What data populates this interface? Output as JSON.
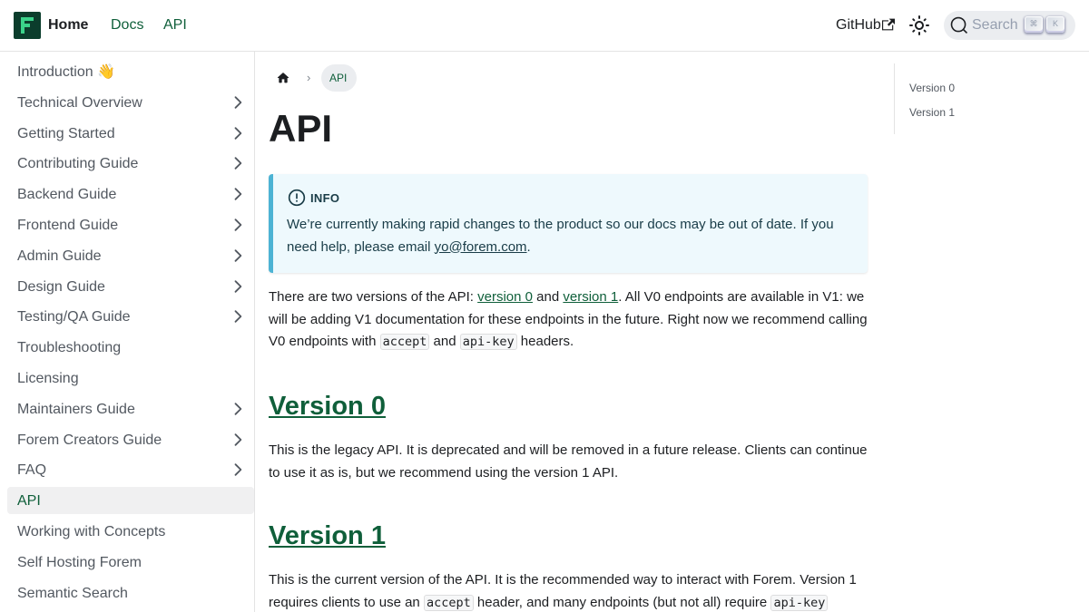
{
  "navbar": {
    "brand": "Home",
    "links": [
      "Docs",
      "API"
    ],
    "github": "GitHub",
    "search_placeholder": "Search",
    "kbd_keys": [
      "⌘",
      "K"
    ]
  },
  "sidebar": {
    "items": [
      {
        "label": "Introduction 👋",
        "has_children": false,
        "active": false
      },
      {
        "label": "Technical Overview",
        "has_children": true,
        "active": false
      },
      {
        "label": "Getting Started",
        "has_children": true,
        "active": false
      },
      {
        "label": "Contributing Guide",
        "has_children": true,
        "active": false
      },
      {
        "label": "Backend Guide",
        "has_children": true,
        "active": false
      },
      {
        "label": "Frontend Guide",
        "has_children": true,
        "active": false
      },
      {
        "label": "Admin Guide",
        "has_children": true,
        "active": false
      },
      {
        "label": "Design Guide",
        "has_children": true,
        "active": false
      },
      {
        "label": "Testing/QA Guide",
        "has_children": true,
        "active": false
      },
      {
        "label": "Troubleshooting",
        "has_children": false,
        "active": false
      },
      {
        "label": "Licensing",
        "has_children": false,
        "active": false
      },
      {
        "label": "Maintainers Guide",
        "has_children": true,
        "active": false
      },
      {
        "label": "Forem Creators Guide",
        "has_children": true,
        "active": false
      },
      {
        "label": "FAQ",
        "has_children": true,
        "active": false
      },
      {
        "label": "API",
        "has_children": false,
        "active": true
      },
      {
        "label": "Working with Concepts",
        "has_children": false,
        "active": false
      },
      {
        "label": "Self Hosting Forem",
        "has_children": false,
        "active": false
      },
      {
        "label": "Semantic Search",
        "has_children": false,
        "active": false
      }
    ]
  },
  "breadcrumb": {
    "current": "API"
  },
  "page": {
    "title": "API",
    "info": {
      "title": "INFO",
      "text_before": "We’re currently making rapid changes to the product so our docs may be out of date. If you need help, please email ",
      "email": "yo@forem.com",
      "text_after": "."
    },
    "intro": {
      "t1": "There are two versions of the API: ",
      "link1": "version 0",
      "t2": " and ",
      "link2": "version 1",
      "t3": ". All V0 endpoints are available in V1: we will be adding V1 documentation for these endpoints in the future. Right now we recommend calling V0 endpoints with ",
      "code1": "accept",
      "t4": " and ",
      "code2": "api-key",
      "t5": " headers."
    },
    "v0": {
      "heading": "Version 0",
      "text": "This is the legacy API. It is deprecated and will be removed in a future release. Clients can continue to use it as is, but we recommend using the version 1 API."
    },
    "v1": {
      "heading": "Version 1",
      "t1": "This is the current version of the API. It is the recommended way to interact with Forem. Version 1 requires clients to use an ",
      "code1": "accept",
      "t2": " header, and many endpoints (but not all) require ",
      "code2": "api-key"
    }
  },
  "toc": {
    "items": [
      "Version 0",
      "Version 1"
    ]
  }
}
